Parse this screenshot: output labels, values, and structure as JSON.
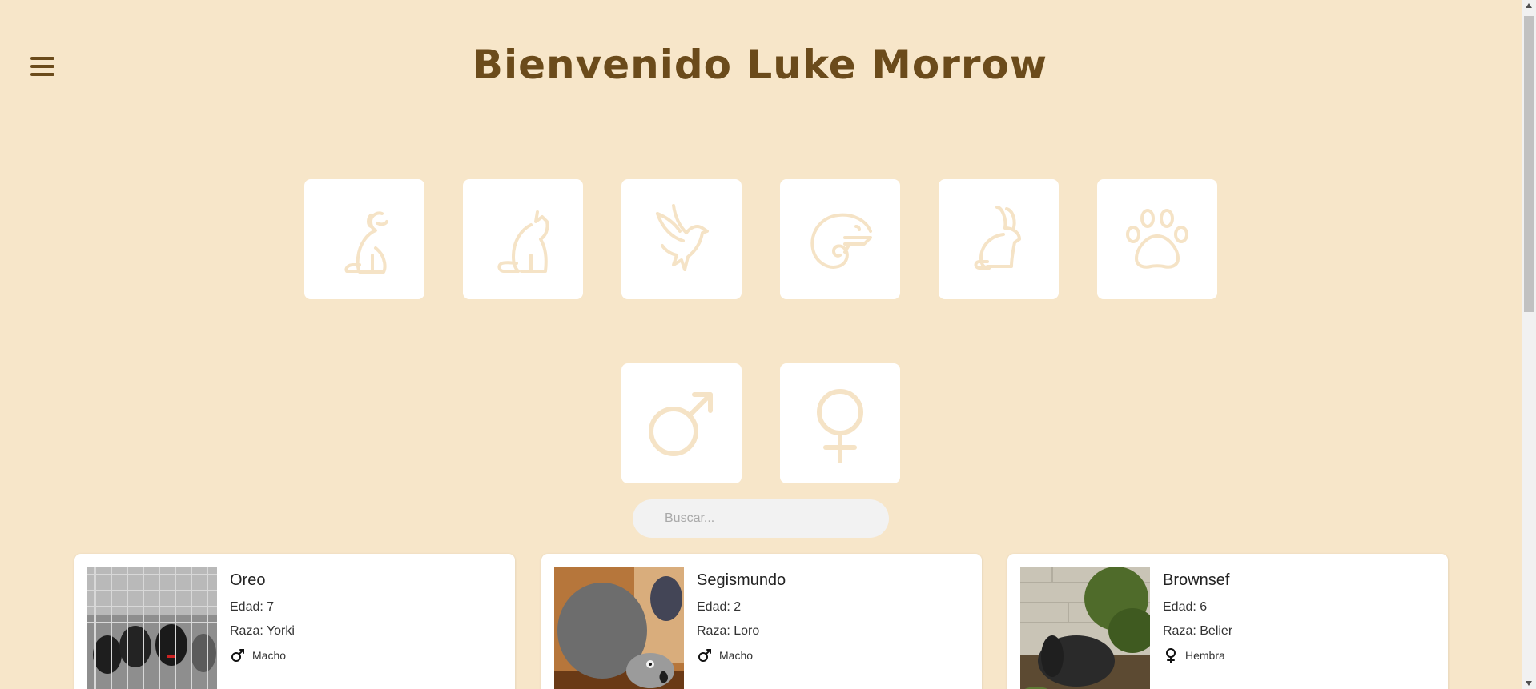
{
  "header": {
    "title": "Bienvenido Luke Morrow",
    "menu_icon": "hamburger-menu-icon"
  },
  "categories": [
    {
      "name": "dog",
      "icon": "dog-icon"
    },
    {
      "name": "cat",
      "icon": "cat-icon"
    },
    {
      "name": "bird",
      "icon": "bird-icon"
    },
    {
      "name": "reptile",
      "icon": "chameleon-icon"
    },
    {
      "name": "rabbit",
      "icon": "rabbit-icon"
    },
    {
      "name": "other",
      "icon": "paw-icon"
    }
  ],
  "sex_filters": [
    {
      "name": "male",
      "icon": "male-symbol-icon"
    },
    {
      "name": "female",
      "icon": "female-symbol-icon"
    }
  ],
  "search": {
    "placeholder": "Buscar..."
  },
  "pets": [
    {
      "name": "Oreo",
      "age": "Edad: 7",
      "breed": "Raza: Yorki",
      "sex": "Macho",
      "sex_icon": "male-symbol-icon"
    },
    {
      "name": "Segismundo",
      "age": "Edad: 2",
      "breed": "Raza: Loro",
      "sex": "Macho",
      "sex_icon": "male-symbol-icon"
    },
    {
      "name": "Brownsef",
      "age": "Edad: 6",
      "breed": "Raza: Belier",
      "sex": "Hembra",
      "sex_icon": "female-symbol-icon"
    }
  ],
  "colors": {
    "background": "#f7e6c9",
    "title": "#6b4b1b",
    "icon_stroke": "#f5e3c6",
    "tile": "#ffffff"
  }
}
